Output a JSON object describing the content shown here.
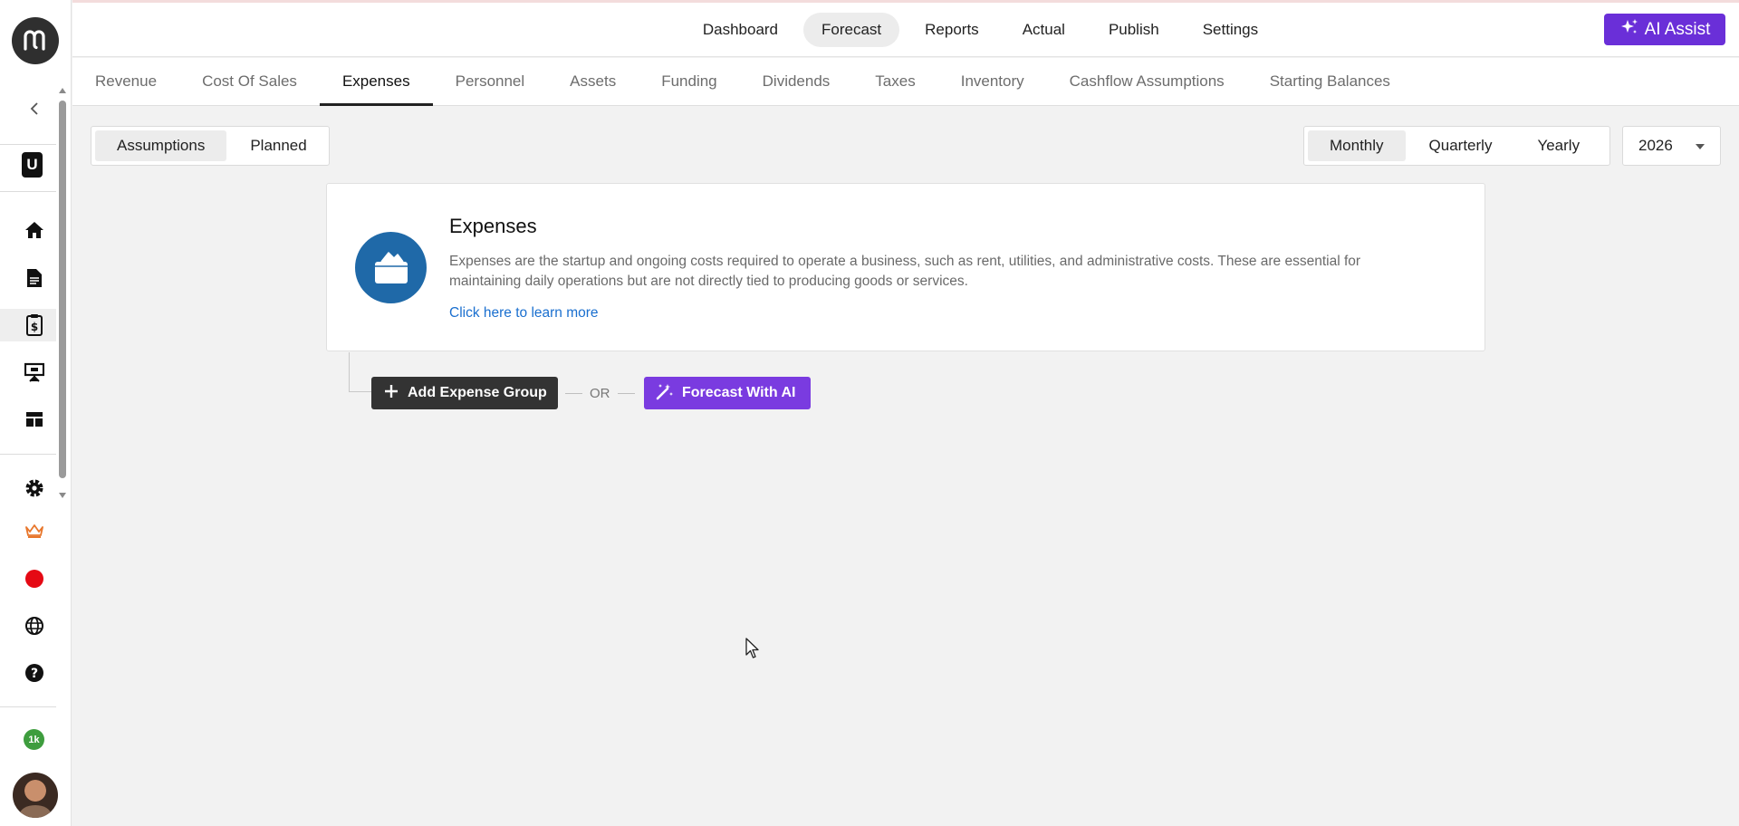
{
  "top_nav": {
    "items": [
      {
        "label": "Dashboard",
        "active": false
      },
      {
        "label": "Forecast",
        "active": true
      },
      {
        "label": "Reports",
        "active": false
      },
      {
        "label": "Actual",
        "active": false
      },
      {
        "label": "Publish",
        "active": false
      },
      {
        "label": "Settings",
        "active": false
      }
    ],
    "ai_assist_label": "AI Assist"
  },
  "sub_tabs": {
    "items": [
      {
        "label": "Revenue",
        "active": false
      },
      {
        "label": "Cost Of Sales",
        "active": false
      },
      {
        "label": "Expenses",
        "active": true
      },
      {
        "label": "Personnel",
        "active": false
      },
      {
        "label": "Assets",
        "active": false
      },
      {
        "label": "Funding",
        "active": false
      },
      {
        "label": "Dividends",
        "active": false
      },
      {
        "label": "Taxes",
        "active": false
      },
      {
        "label": "Inventory",
        "active": false
      },
      {
        "label": "Cashflow Assumptions",
        "active": false
      },
      {
        "label": "Starting Balances",
        "active": false
      }
    ]
  },
  "view_toggle": {
    "options": [
      "Assumptions",
      "Planned"
    ],
    "selected": "Assumptions"
  },
  "period_toggle": {
    "options": [
      "Monthly",
      "Quarterly",
      "Yearly"
    ],
    "selected": "Monthly"
  },
  "year_select": {
    "value": "2026"
  },
  "info_card": {
    "title": "Expenses",
    "description": "Expenses are the startup and ongoing costs required to operate a business, such as rent, utilities, and administrative costs. These are essential for maintaining daily operations but are not directly tied to producing goods or services.",
    "link": "Click here to learn more"
  },
  "actions": {
    "add_label": "Add Expense Group",
    "or_label": "OR",
    "ai_label": "Forecast With AI"
  },
  "sidebar": {
    "workspace_letter": "U",
    "badge": "1k",
    "icons": [
      "home-icon",
      "document-icon",
      "clipboard-dollar-icon",
      "presentation-icon",
      "dashboard-icon",
      "gear-icon",
      "crown-icon",
      "record-icon",
      "globe-icon",
      "help-icon"
    ]
  },
  "colors": {
    "accent_purple": "#6a2fd8",
    "ai_button": "#7a3be0",
    "card_icon_blue": "#1f69a8",
    "link_blue": "#1a6fcf",
    "crown_orange": "#e8762b",
    "record_red": "#e50914",
    "badge_green": "#3e9d3e"
  }
}
